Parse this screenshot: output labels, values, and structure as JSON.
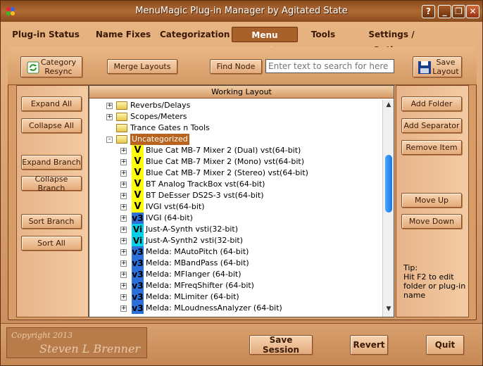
{
  "window": {
    "title": "MenuMagic Plug-in Manager by Agitated State"
  },
  "title_buttons": {
    "help": "?",
    "minimize": "_",
    "restore": "❐",
    "close": "✕"
  },
  "tabs": [
    {
      "label": "Plug-in Status"
    },
    {
      "label": "Name Fixes"
    },
    {
      "label": "Categorization"
    },
    {
      "label": "Menu Creation"
    },
    {
      "label": "Tools"
    },
    {
      "label": "Settings / Options"
    }
  ],
  "toolbar": {
    "category_resync_line1": "Category",
    "category_resync_line2": "Resync",
    "merge_layouts": "Merge Layouts",
    "find_node": "Find Node",
    "search_placeholder": "Enter text to search for here",
    "save_layout_line1": "Save",
    "save_layout_line2": "Layout"
  },
  "left_buttons": {
    "expand_all": "Expand All",
    "collapse_all": "Collapse All",
    "expand_branch": "Expand Branch",
    "collapse_branch": "Collapse Branch",
    "sort_branch": "Sort Branch",
    "sort_all": "Sort All"
  },
  "right_buttons": {
    "add_folder": "Add Folder",
    "add_separator": "Add Separator",
    "remove_item": "Remove Item",
    "move_up": "Move Up",
    "move_down": "Move Down"
  },
  "tip": {
    "line1": "Tip:",
    "line2": "Hit F2 to edit",
    "line3": "folder or plug-in",
    "line4": "name"
  },
  "tree": {
    "header": "Working Layout",
    "items": [
      {
        "label": "Reverbs/Delays",
        "level": 0,
        "folder": true,
        "expander": "+"
      },
      {
        "label": "Scopes/Meters",
        "level": 0,
        "folder": true,
        "expander": "+"
      },
      {
        "label": "Trance Gates n Tools",
        "level": 0,
        "folder": true,
        "expander": ""
      },
      {
        "label": "Uncategorized",
        "level": 0,
        "folder": true,
        "expander": "-",
        "selected": true
      },
      {
        "label": "Blue Cat MB-7 Mixer 2 (Dual) vst(64-bit)",
        "level": 1,
        "badge": "V",
        "badge_type": "v",
        "expander": "+"
      },
      {
        "label": "Blue Cat MB-7 Mixer 2 (Mono) vst(64-bit)",
        "level": 1,
        "badge": "V",
        "badge_type": "v",
        "expander": "+"
      },
      {
        "label": "Blue Cat MB-7 Mixer 2 (Stereo) vst(64-bit)",
        "level": 1,
        "badge": "V",
        "badge_type": "v",
        "expander": "+"
      },
      {
        "label": "BT Analog TrackBox vst(64-bit)",
        "level": 1,
        "badge": "V",
        "badge_type": "v",
        "expander": "+"
      },
      {
        "label": "BT DeEsser DS2S-3 vst(64-bit)",
        "level": 1,
        "badge": "V",
        "badge_type": "v",
        "expander": "+"
      },
      {
        "label": "IVGI vst(64-bit)",
        "level": 1,
        "badge": "V",
        "badge_type": "v",
        "expander": "+"
      },
      {
        "label": "IVGI (64-bit)",
        "level": 1,
        "badge": "v3",
        "badge_type": "v3",
        "expander": "+"
      },
      {
        "label": "Just-A-Synth vsti(32-bit)",
        "level": 1,
        "badge": "Vi",
        "badge_type": "vi",
        "expander": "+"
      },
      {
        "label": "Just-A-Synth2 vsti(32-bit)",
        "level": 1,
        "badge": "Vi",
        "badge_type": "vi",
        "expander": "+"
      },
      {
        "label": "Melda: MAutoPitch (64-bit)",
        "level": 1,
        "badge": "v3",
        "badge_type": "v3",
        "expander": "+"
      },
      {
        "label": "Melda: MBandPass (64-bit)",
        "level": 1,
        "badge": "v3",
        "badge_type": "v3",
        "expander": "+"
      },
      {
        "label": "Melda: MFlanger (64-bit)",
        "level": 1,
        "badge": "v3",
        "badge_type": "v3",
        "expander": "+"
      },
      {
        "label": "Melda: MFreqShifter (64-bit)",
        "level": 1,
        "badge": "v3",
        "badge_type": "v3",
        "expander": "+"
      },
      {
        "label": "Melda: MLimiter (64-bit)",
        "level": 1,
        "badge": "v3",
        "badge_type": "v3",
        "expander": "+"
      },
      {
        "label": "Melda: MLoudnessAnalyzer (64-bit)",
        "level": 1,
        "badge": "v3",
        "badge_type": "v3",
        "expander": "+"
      }
    ]
  },
  "bottom": {
    "copyright_line1": "Copyright 2013",
    "copyright_line2": "Steven L Brenner",
    "save_session": "Save Session",
    "revert": "Revert",
    "quit": "Quit"
  },
  "colors": {
    "accent": "#a9612c",
    "selected": "#b8641e",
    "badge_v": "#ffff00",
    "badge_v3": "#2d6fd8",
    "badge_vi": "#00d0e8"
  }
}
